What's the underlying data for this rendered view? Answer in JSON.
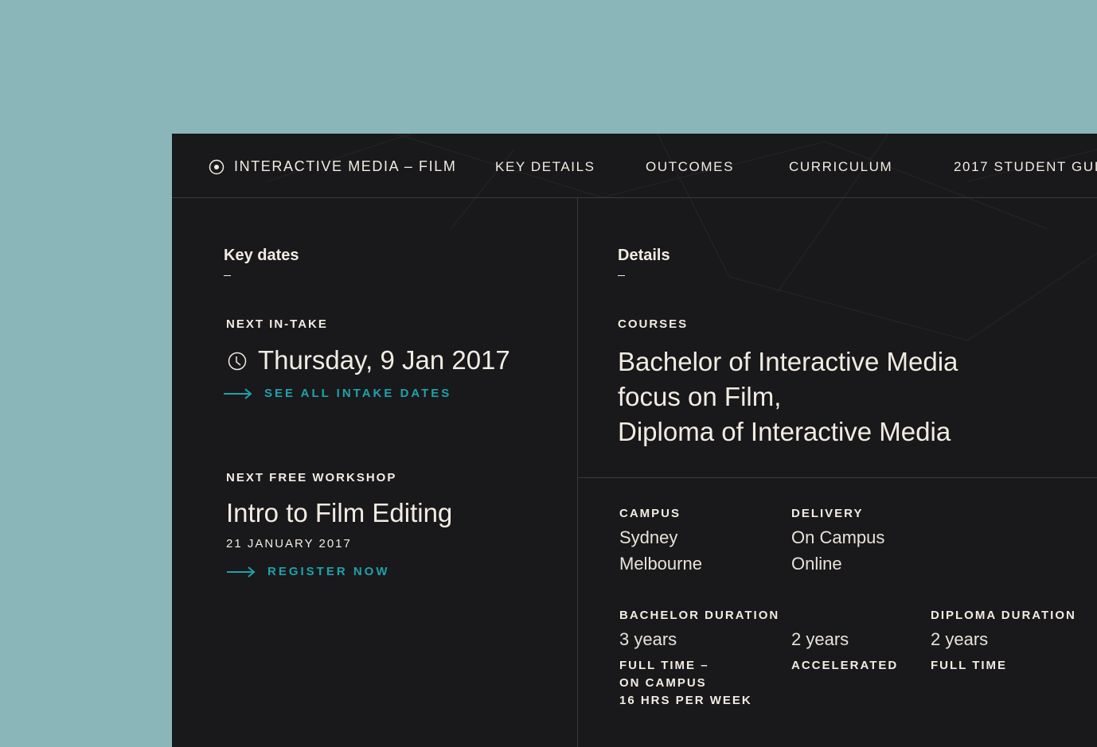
{
  "nav": {
    "brand": "INTERACTIVE MEDIA – FILM",
    "items": [
      "KEY DETAILS",
      "OUTCOMES",
      "CURRICULUM",
      "2017 STUDENT GUI"
    ]
  },
  "key_dates": {
    "title": "Key dates",
    "intake_label": "NEXT IN-TAKE",
    "intake_date": "Thursday, 9 Jan 2017",
    "intake_link": "SEE ALL INTAKE DATES",
    "workshop_label": "NEXT FREE WORKSHOP",
    "workshop_title": "Intro to Film Editing",
    "workshop_date": "21 JANUARY 2017",
    "workshop_link": "REGISTER NOW"
  },
  "details": {
    "title": "Details",
    "courses_label": "COURSES",
    "courses": [
      "Bachelor of Interactive Media",
      "focus on Film,",
      "Diploma of Interactive Media"
    ],
    "campus_label": "CAMPUS",
    "campus": [
      "Sydney",
      "Melbourne"
    ],
    "delivery_label": "DELIVERY",
    "delivery": [
      "On Campus",
      "Online"
    ],
    "bachelor_label": "BACHELOR DURATION",
    "bachelor_ft_value": "3 years",
    "bachelor_ft_desc": [
      "FULL TIME –",
      "ON CAMPUS",
      "16 HRS PER WEEK"
    ],
    "bachelor_acc_value": "2 years",
    "bachelor_acc_desc": "ACCELERATED",
    "diploma_label": "DIPLOMA DURATION",
    "diploma_value": "2 years",
    "diploma_desc": "FULL TIME"
  },
  "colors": {
    "background": "#8ab6b9",
    "panel": "#19181a",
    "text": "#f1ece3",
    "accent": "#1ea2ad"
  }
}
